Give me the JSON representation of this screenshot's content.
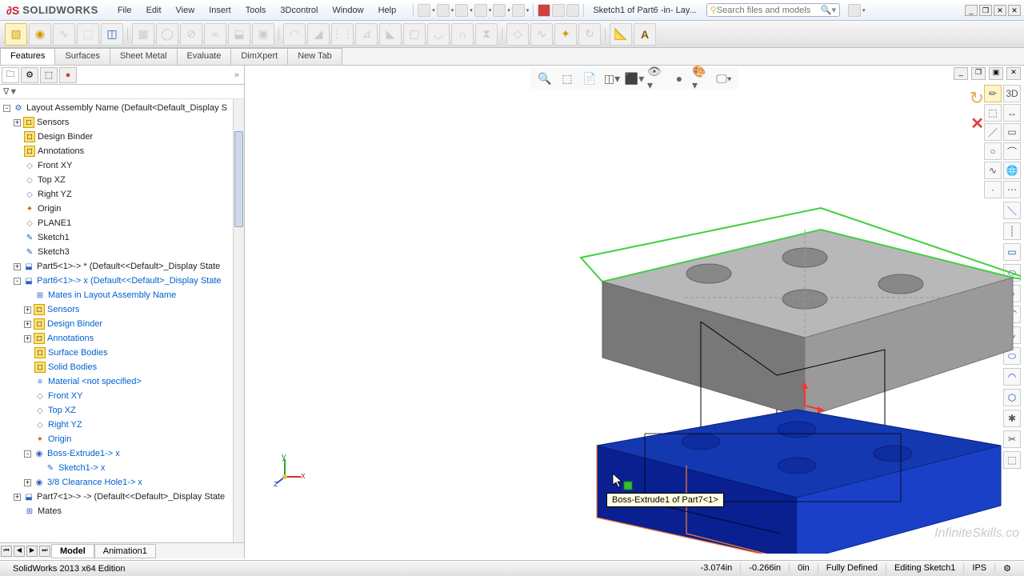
{
  "app": {
    "name": "SOLIDWORKS"
  },
  "menu": [
    "File",
    "Edit",
    "View",
    "Insert",
    "Tools",
    "3Dcontrol",
    "Window",
    "Help"
  ],
  "breadcrumb": "Sketch1 of Part6 -in- Lay...",
  "search": {
    "placeholder": "Search files and models"
  },
  "tabs": [
    "Features",
    "Surfaces",
    "Sheet Metal",
    "Evaluate",
    "DimXpert",
    "New Tab"
  ],
  "active_tab": "Features",
  "filter_label": "▼",
  "tree": [
    {
      "d": 0,
      "e": "-",
      "i": "asm",
      "t": "Layout Assembly Name  (Default<Default_Display S"
    },
    {
      "d": 1,
      "e": "+",
      "i": "yel",
      "t": "Sensors"
    },
    {
      "d": 1,
      "e": "",
      "i": "yel",
      "t": "Design Binder"
    },
    {
      "d": 1,
      "e": "",
      "i": "yel",
      "t": "Annotations"
    },
    {
      "d": 1,
      "e": "",
      "i": "pl",
      "t": "Front XY"
    },
    {
      "d": 1,
      "e": "",
      "i": "pl",
      "t": "Top XZ"
    },
    {
      "d": 1,
      "e": "",
      "i": "pl",
      "t": "Right YZ"
    },
    {
      "d": 1,
      "e": "",
      "i": "or",
      "t": "Origin"
    },
    {
      "d": 1,
      "e": "",
      "i": "pl",
      "t": "PLANE1"
    },
    {
      "d": 1,
      "e": "",
      "i": "sk",
      "t": "Sketch1"
    },
    {
      "d": 1,
      "e": "",
      "i": "sk",
      "t": "Sketch3"
    },
    {
      "d": 1,
      "e": "+",
      "i": "prt",
      "t": "Part5<1>-> * (Default<<Default>_Display State"
    },
    {
      "d": 1,
      "e": "-",
      "i": "prt",
      "t": "Part6<1>-> x (Default<<Default>_Display State",
      "blue": true
    },
    {
      "d": 2,
      "e": "",
      "i": "mate",
      "t": "Mates in Layout Assembly Name",
      "blue": true
    },
    {
      "d": 2,
      "e": "+",
      "i": "yel",
      "t": "Sensors",
      "blue": true
    },
    {
      "d": 2,
      "e": "+",
      "i": "yel",
      "t": "Design Binder",
      "blue": true
    },
    {
      "d": 2,
      "e": "+",
      "i": "yel",
      "t": "Annotations",
      "blue": true
    },
    {
      "d": 2,
      "e": "",
      "i": "yel",
      "t": "Surface Bodies",
      "blue": true
    },
    {
      "d": 2,
      "e": "",
      "i": "yel",
      "t": "Solid Bodies",
      "blue": true
    },
    {
      "d": 2,
      "e": "",
      "i": "mat",
      "t": "Material <not specified>",
      "blue": true
    },
    {
      "d": 2,
      "e": "",
      "i": "pl",
      "t": "Front XY",
      "blue": true
    },
    {
      "d": 2,
      "e": "",
      "i": "pl",
      "t": "Top XZ",
      "blue": true
    },
    {
      "d": 2,
      "e": "",
      "i": "pl",
      "t": "Right YZ",
      "blue": true
    },
    {
      "d": 2,
      "e": "",
      "i": "or",
      "t": "Origin",
      "blue": true
    },
    {
      "d": 2,
      "e": "-",
      "i": "feat",
      "t": "Boss-Extrude1-> x",
      "blue": true
    },
    {
      "d": 3,
      "e": "",
      "i": "sk",
      "t": "Sketch1-> x",
      "blue": true
    },
    {
      "d": 2,
      "e": "+",
      "i": "feat",
      "t": "3/8 Clearance Hole1-> x",
      "blue": true
    },
    {
      "d": 1,
      "e": "+",
      "i": "prt",
      "t": "Part7<1>-> -> (Default<<Default>_Display State"
    },
    {
      "d": 1,
      "e": "",
      "i": "mate",
      "t": "Mates"
    }
  ],
  "view_tabs": [
    "Model",
    "Animation1"
  ],
  "tooltip": "Boss-Extrude1 of Part7<1>",
  "triad": {
    "x": "x",
    "y": "y",
    "z": "z"
  },
  "status": {
    "left": "SolidWorks 2013 x64 Edition",
    "coord_x": "-3.074in",
    "coord_y": "-0.266in",
    "coord_z": "0in",
    "state": "Fully Defined",
    "mode": "Editing Sketch1",
    "units": "IPS"
  },
  "watermark": "InfiniteSkills.co"
}
